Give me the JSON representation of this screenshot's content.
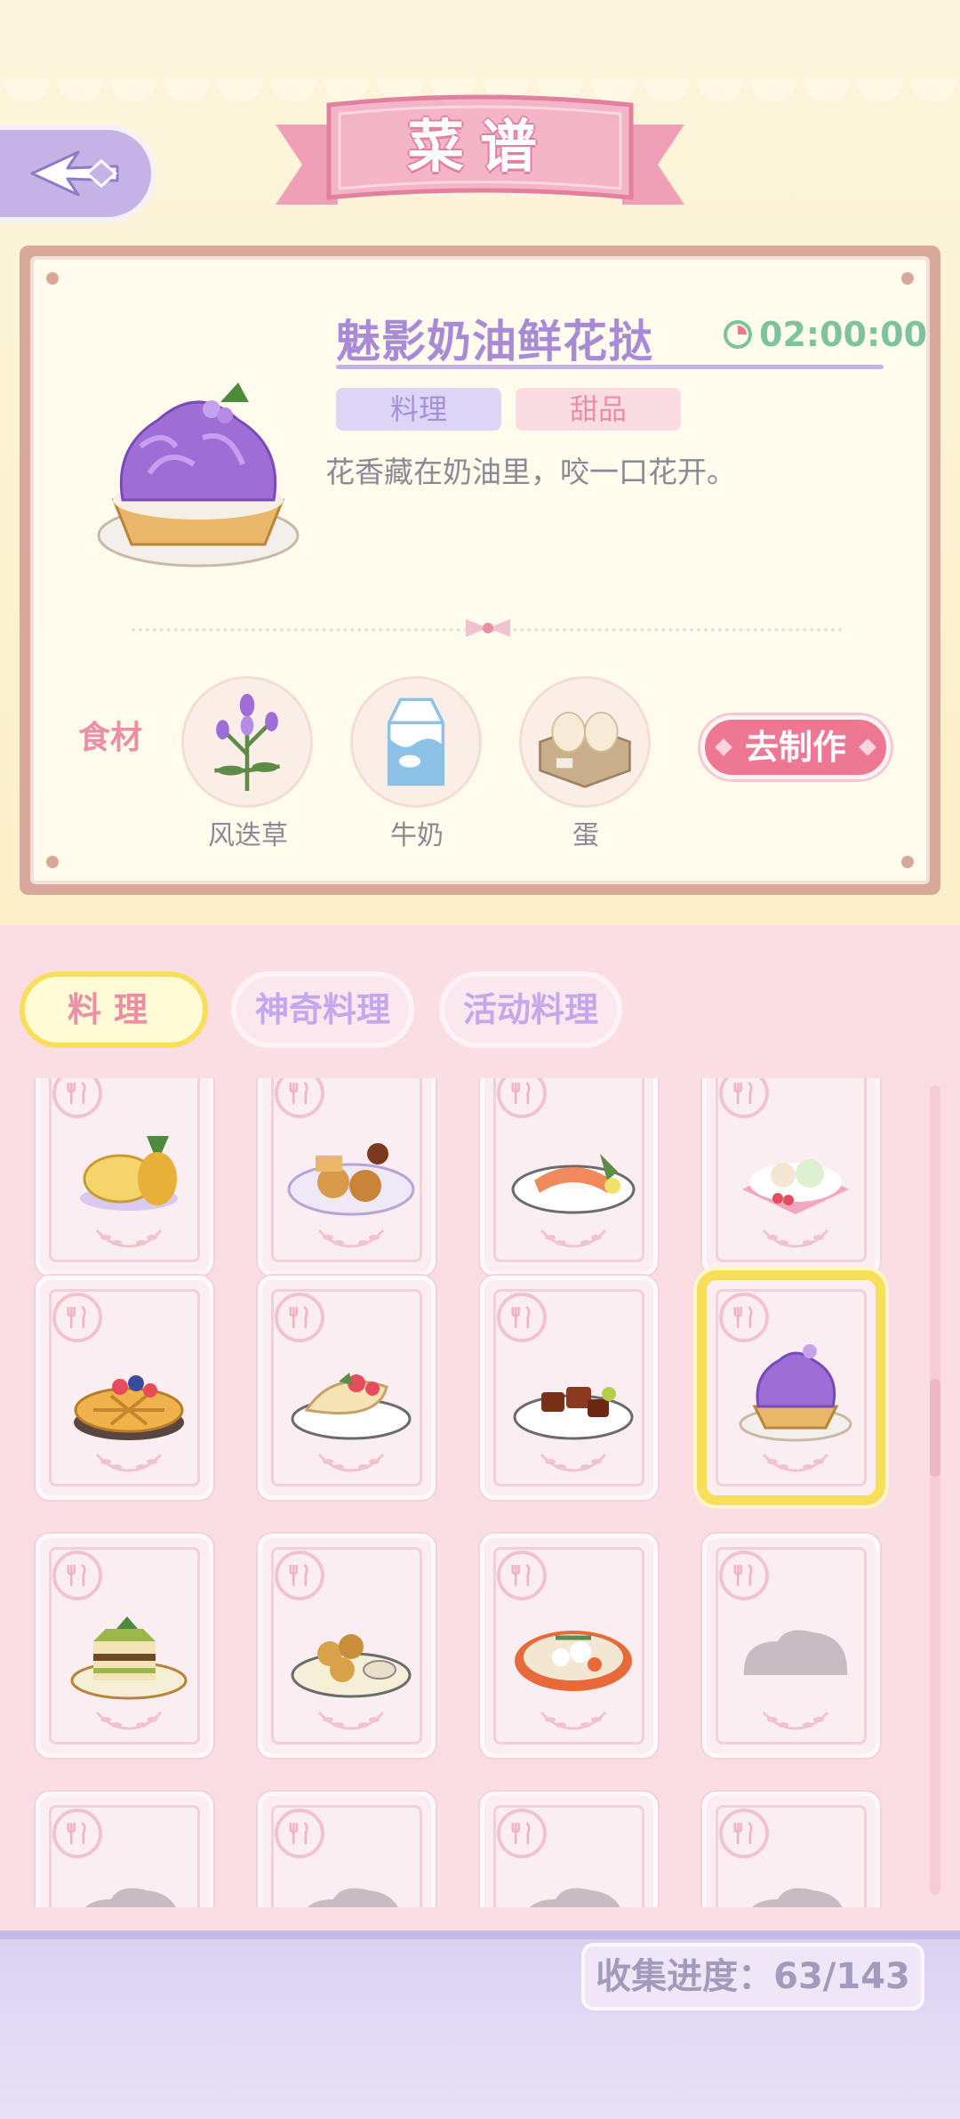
{
  "header": {
    "title": "菜谱"
  },
  "recipe": {
    "name": "魅影奶油鲜花挞",
    "time": "02:00:00",
    "tags": [
      "料理",
      "甜品"
    ],
    "description": "花香藏在奶油里，咬一口花开。",
    "ingredients_label": "食材",
    "ingredients": [
      {
        "name": "风迭草",
        "icon": "lavender-herb-icon"
      },
      {
        "name": "牛奶",
        "icon": "milk-carton-icon"
      },
      {
        "name": "蛋",
        "icon": "egg-tray-icon"
      }
    ],
    "make_button": "去制作"
  },
  "tabs": [
    {
      "label": "料理",
      "active": true
    },
    {
      "label": "神奇料理",
      "active": false
    },
    {
      "label": "活动料理",
      "active": false
    }
  ],
  "grid": {
    "rows": [
      [
        "pineapple-soup",
        "fried-platter",
        "salmon-sashimi",
        "fruit-salad"
      ],
      [
        "berry-pie",
        "fruit-crepe",
        "braised-pork",
        "violet-cream-tart"
      ],
      [
        "matcha-cake",
        "croquettes",
        "ramen-bowl",
        "locked"
      ],
      [
        "locked",
        "locked",
        "locked",
        "locked"
      ]
    ],
    "selected": "violet-cream-tart"
  },
  "progress": {
    "label": "收集进度：63/143"
  },
  "colors": {
    "accent_pink": "#ee7893",
    "accent_purple": "#a98ad6",
    "accent_yellow": "#f8df5b",
    "timer_green": "#7ec29e"
  }
}
